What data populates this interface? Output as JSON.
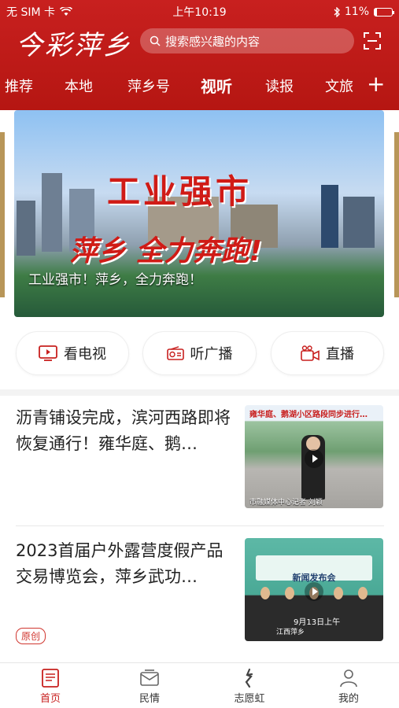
{
  "status_bar": {
    "carrier": "无 SIM 卡",
    "time": "上午10:19",
    "battery": "11%"
  },
  "header": {
    "logo": "今彩萍乡",
    "search_placeholder": "搜索感兴趣的内容"
  },
  "nav_tabs": [
    {
      "label": "推荐",
      "active": false
    },
    {
      "label": "本地",
      "active": false
    },
    {
      "label": "萍乡号",
      "active": false
    },
    {
      "label": "视听",
      "active": true
    },
    {
      "label": "读报",
      "active": false
    },
    {
      "label": "文旅",
      "active": false
    }
  ],
  "banner": {
    "headline_line1": "工业强市",
    "headline_line2": "萍乡 全力奔跑!",
    "caption": "工业强市！萍乡，全力奔跑！"
  },
  "quick_actions": [
    {
      "label": "看电视",
      "icon": "tv-icon"
    },
    {
      "label": "听广播",
      "icon": "radio-icon"
    },
    {
      "label": "直播",
      "icon": "live-camera-icon"
    }
  ],
  "news": [
    {
      "title": "沥青铺设完成，滨河西路即将恢复通行！雍华庭、鹅…",
      "thumb_caption": "雍华庭、鹅湖小区路段同步进行…",
      "thumb_credit": "市融媒体中心记者 刘颖"
    },
    {
      "title": "2023首届户外露营度假产品交易博览会，萍乡武功…",
      "badge": "原创",
      "thumb_caption": "新闻发布会",
      "thumb_subcaption": "9月13日上午",
      "thumb_place": "江西萍乡"
    }
  ],
  "tabbar": [
    {
      "label": "首页",
      "active": true
    },
    {
      "label": "民情",
      "active": false
    },
    {
      "label": "志愿虹",
      "active": false
    },
    {
      "label": "我的",
      "active": false
    }
  ],
  "colors": {
    "brand_red": "#c8201f",
    "text": "#222222"
  }
}
